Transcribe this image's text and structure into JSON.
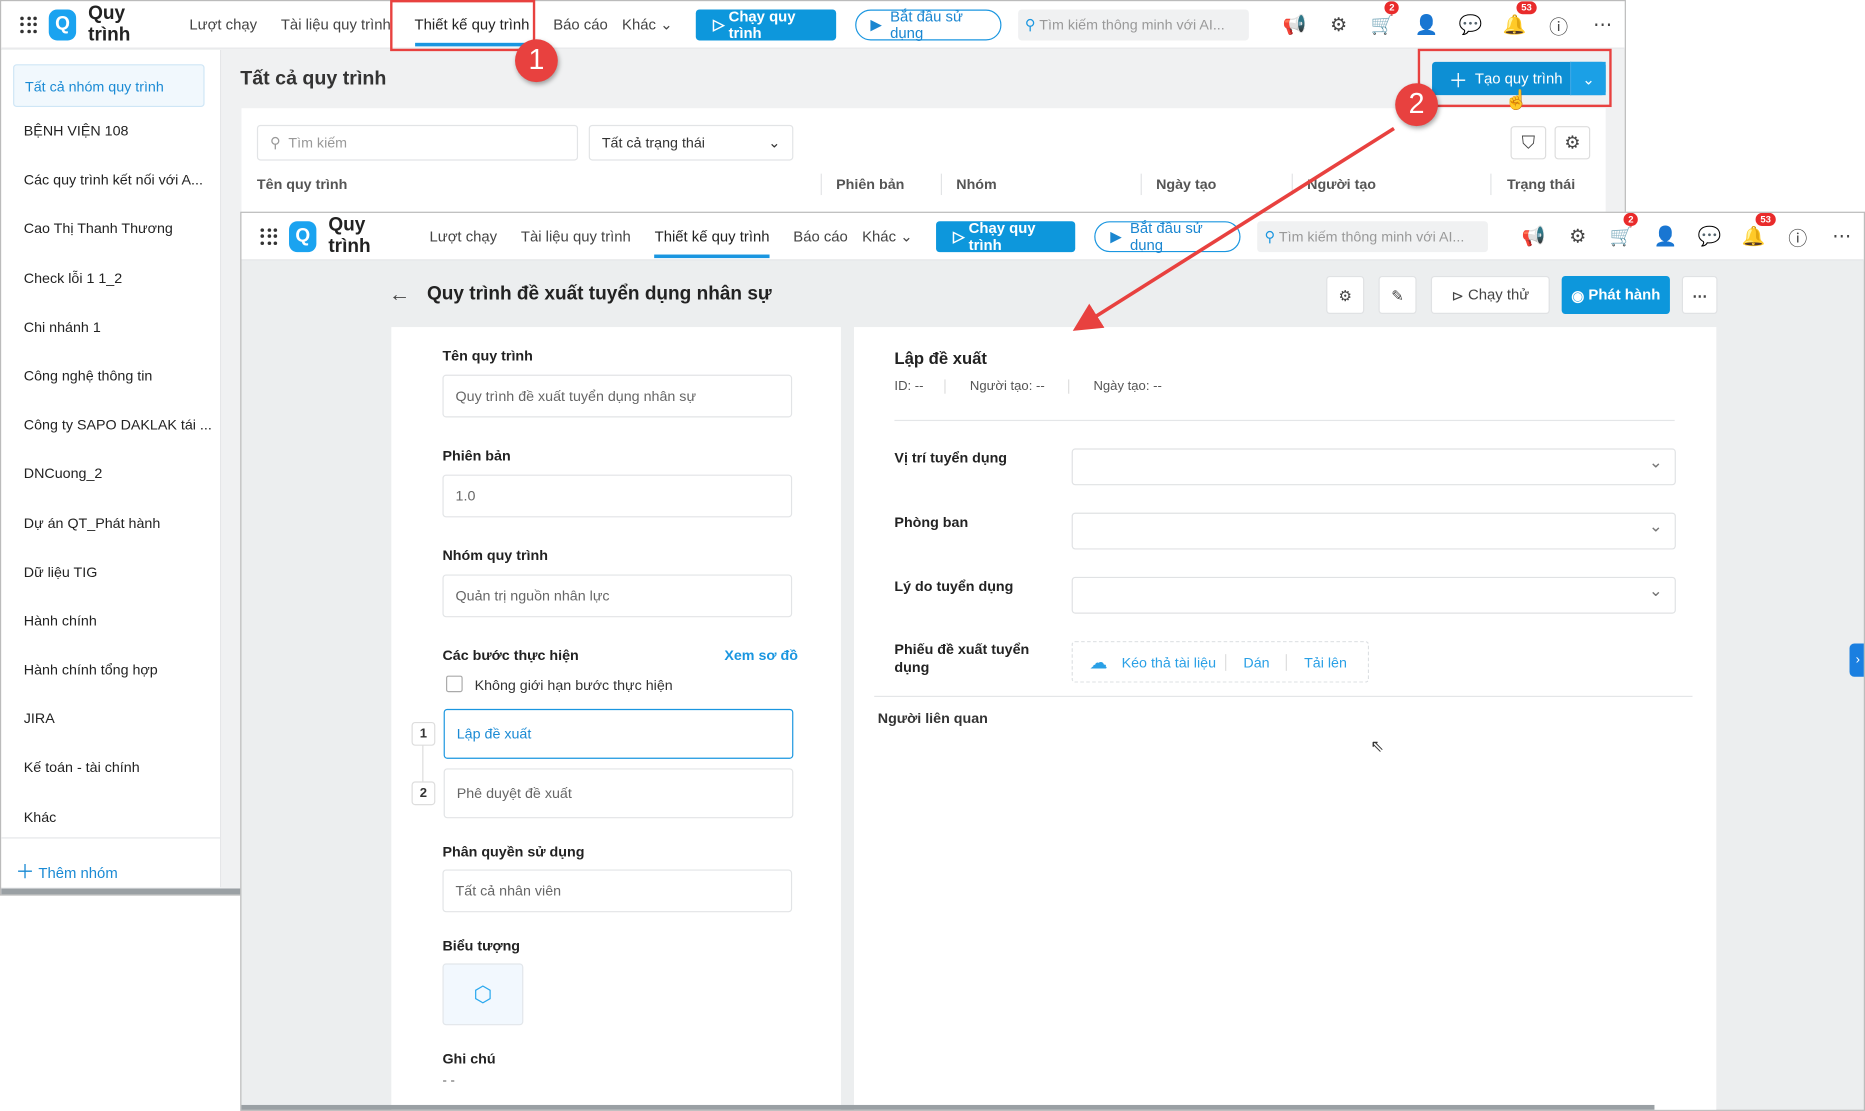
{
  "nav": {
    "brand": "Quy trình",
    "tabs": [
      "Lượt chạy",
      "Tài liệu quy trình",
      "Thiết kế quy trình",
      "Báo cáo",
      "Khác"
    ],
    "run_button": "Chạy quy trình",
    "start_button": "Bắt đầu sử dụng",
    "search_placeholder": "Tìm kiếm thông minh với AI...",
    "cart_badge": "2",
    "notification_badge": "53"
  },
  "list_page": {
    "title": "Tất cả quy trình",
    "create_button": "Tạo quy trình",
    "search_placeholder": "Tìm kiếm",
    "status_filter": "Tất cả trạng thái",
    "columns": [
      "Tên quy trình",
      "Phiên bản",
      "Nhóm",
      "Ngày tạo",
      "Người tạo",
      "Trạng thái"
    ],
    "sidebar": {
      "items": [
        "Tất cả nhóm quy trình",
        "BỆNH VIỆN 108",
        "Các quy trình kết nối với A...",
        "Cao Thị Thanh Thương",
        "Check lỗi 1 1_2",
        "Chi nhánh 1",
        "Công nghệ thông tin",
        "Công ty SAPO DAKLAK tái ...",
        "DNCuong_2",
        "Dự án QT_Phát hành",
        "Dữ liệu TIG",
        "Hành chính",
        "Hành chính tổng hợp",
        "JIRA",
        "Kế toán - tài chính",
        "Khác"
      ],
      "add_group": "Thêm nhóm"
    }
  },
  "design_page": {
    "title": "Quy trình đề xuất tuyển dụng nhân sự",
    "test_run_button": "Chạy thử",
    "publish_button": "Phát hành",
    "form": {
      "name_label": "Tên quy trình",
      "name_value": "Quy trình đề xuất tuyển dụng nhân sự",
      "version_label": "Phiên bản",
      "version_value": "1.0",
      "group_label": "Nhóm quy trình",
      "group_value": "Quản trị nguồn nhân lực",
      "steps_label": "Các bước thực hiện",
      "view_diagram": "Xem sơ đồ",
      "unlimited_steps": "Không giới hạn bước thực hiện",
      "steps": [
        {
          "n": "1",
          "name": "Lập đề xuất"
        },
        {
          "n": "2",
          "name": "Phê duyệt đề xuất"
        }
      ],
      "permission_label": "Phân quyền sử dụng",
      "permission_value": "Tất cả nhân viên",
      "icon_label": "Biểu tượng",
      "note_label": "Ghi chú",
      "note_value": "- -"
    },
    "step_detail": {
      "title": "Lập đề xuất",
      "meta": [
        "ID: --",
        "Người tạo: --",
        "Ngày tạo: --"
      ],
      "fields": [
        "Vị trí tuyển dụng",
        "Phòng ban",
        "Lý do tuyển dụng"
      ],
      "attachment_label": "Phiếu đề xuất tuyển dụng",
      "attachment_actions": [
        "Kéo thả tài liệu",
        "Dán",
        "Tải lên"
      ],
      "related_label": "Người liên quan"
    }
  },
  "annotations": [
    "1",
    "2"
  ],
  "colors": {
    "accent": "#0d97dc",
    "annotation": "#e8413f"
  }
}
